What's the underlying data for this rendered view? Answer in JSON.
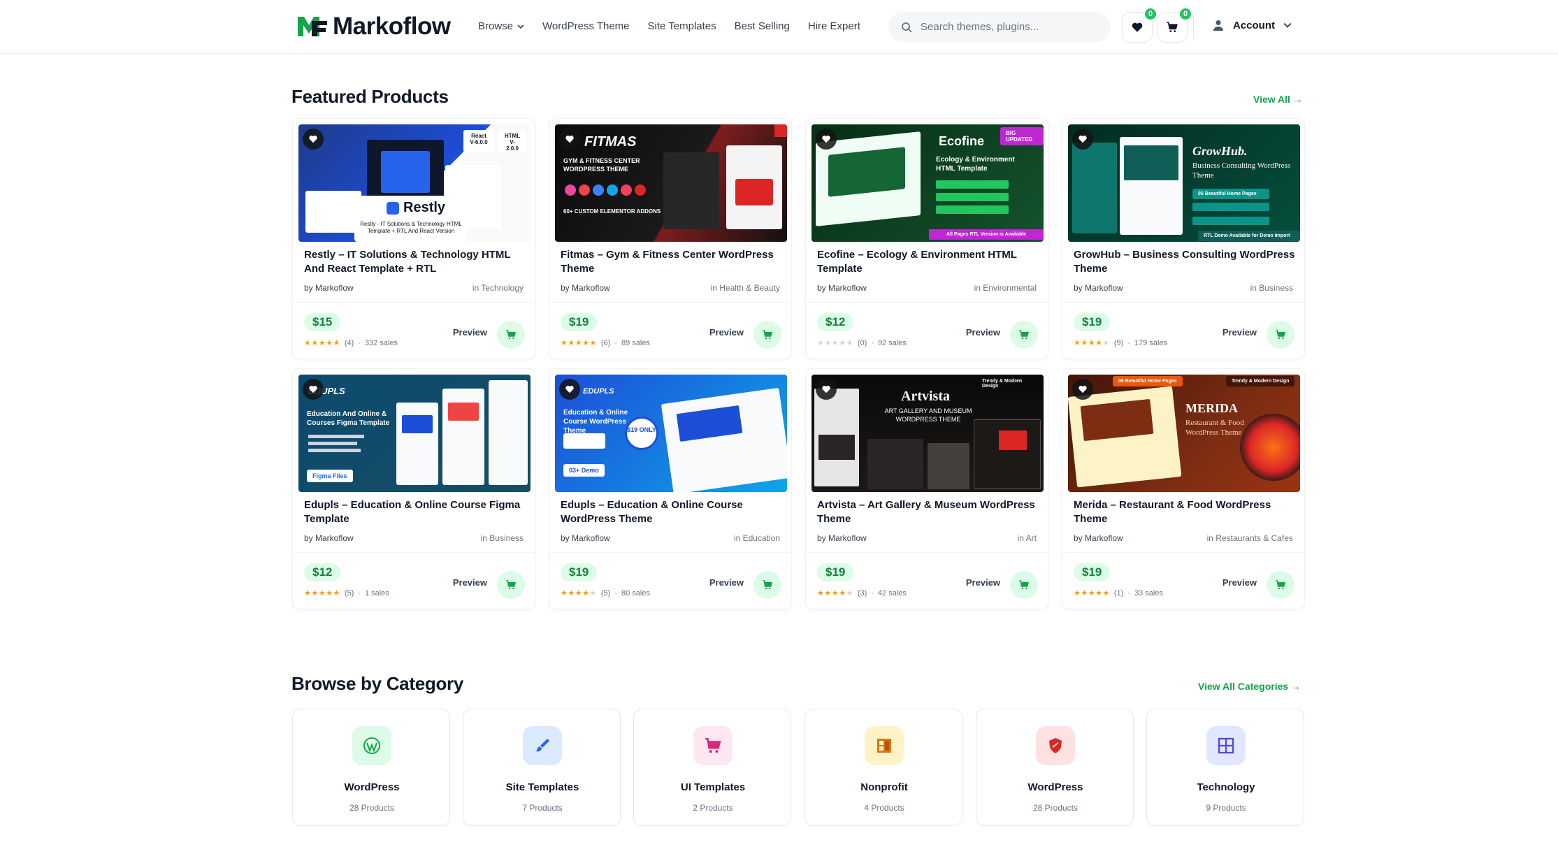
{
  "brand": {
    "name": "Markoflow",
    "accent": "#16a34a"
  },
  "nav": {
    "items": [
      {
        "label": "Browse",
        "has_dropdown": true
      },
      {
        "label": "WordPress Theme"
      },
      {
        "label": "Site Templates"
      },
      {
        "label": "Best Selling"
      },
      {
        "label": "Hire Expert"
      }
    ]
  },
  "search": {
    "placeholder": "Search themes, plugins...",
    "value": ""
  },
  "header_actions": {
    "wishlist_count": "0",
    "cart_count": "0",
    "account_label": "Account"
  },
  "featured": {
    "title": "Featured Products",
    "view_all": "View All →",
    "products": [
      {
        "thumb": {
          "headline": "Restly",
          "tagline": "Restly - IT Solutions & Technology HTML Template + RTL And React Version",
          "pills": [
            "React V-6.0.0",
            "HTML V-2.0.0"
          ]
        },
        "title": "Restly – IT Solutions & Technology HTML And React Template + RTL",
        "author": "by Markoflow",
        "category": "in Technology",
        "price": "$15",
        "rating": 5,
        "reviews": "(4)",
        "sales": "332 sales"
      },
      {
        "thumb": {
          "headline": "FITMAS",
          "tagline": "GYM & FITNESS CENTER WORDPRESS THEME",
          "pills": [
            "60+ CUSTOM ELEMENTOR ADDONS"
          ]
        },
        "title": "Fitmas – Gym & Fitness Center WordPress Theme",
        "author": "by Markoflow",
        "category": "in Health & Beauty",
        "price": "$19",
        "rating": 5,
        "reviews": "(6)",
        "sales": "89 sales"
      },
      {
        "thumb": {
          "headline": "Ecofine",
          "tagline": "Ecology & Environment HTML Template",
          "pills": [
            "BIG UPDATED",
            "All Pages RTL Version is Available"
          ]
        },
        "title": "Ecofine – Ecology & Environment HTML Template",
        "author": "by Markoflow",
        "category": "in Environmental",
        "price": "$12",
        "rating": 0,
        "reviews": "(0)",
        "sales": "92 sales"
      },
      {
        "thumb": {
          "headline": "GrowHub.",
          "tagline": "Business Consulting WordPress Theme",
          "pills": [
            "05 Beautiful Home Pages",
            "RTL Demo Available for Demo Import"
          ]
        },
        "title": "GrowHub – Business Consulting WordPress Theme",
        "author": "by Markoflow",
        "category": "in Business",
        "price": "$19",
        "rating": 4,
        "reviews": "(9)",
        "sales": "179 sales"
      },
      {
        "thumb": {
          "headline": "EDUPLS",
          "tagline": "Education And Online & Courses Figma Template",
          "pills": [
            "Figma Files"
          ]
        },
        "title": "Edupls – Education & Online Course Figma Template",
        "author": "by Markoflow",
        "category": "in Business",
        "price": "$12",
        "rating": 5,
        "reviews": "(5)",
        "sales": "1 sales"
      },
      {
        "thumb": {
          "headline": "EDUPLS",
          "tagline": "Education & Online Course WordPress Theme",
          "pills": [
            "$19 ONLY",
            "03+ Demo"
          ]
        },
        "title": "Edupls – Education & Online Course WordPress Theme",
        "author": "by Markoflow",
        "category": "in Education",
        "price": "$19",
        "rating": 4,
        "reviews": "(5)",
        "sales": "80 sales"
      },
      {
        "thumb": {
          "headline": "Artvista",
          "tagline": "ART GALLERY AND MUSEUM WORDPRESS THEME",
          "pills": [
            "Trendy & Modren Design"
          ]
        },
        "title": "Artvista – Art Gallery & Museum WordPress Theme",
        "author": "by Markoflow",
        "category": "in Art",
        "price": "$19",
        "rating": 4,
        "reviews": "(3)",
        "sales": "42 sales"
      },
      {
        "thumb": {
          "headline": "MERIDA",
          "tagline": "Restaurant & Food WordPress Theme",
          "pills": [
            "06 Beautiful Home Pages",
            "Trendy & Modern Design"
          ]
        },
        "title": "Merida – Restaurant & Food WordPress Theme",
        "author": "by Markoflow",
        "category": "in Restaurants & Cafes",
        "price": "$19",
        "rating": 5,
        "reviews": "(1)",
        "sales": "33 sales"
      }
    ],
    "preview_label": "Preview"
  },
  "categories": {
    "title": "Browse by Category",
    "view_all": "View All Categories →",
    "items": [
      {
        "name": "WordPress",
        "count": "28 Products",
        "icon": "wordpress-icon",
        "bg": "#dcfce7",
        "fg": "#16a34a"
      },
      {
        "name": "Site Templates",
        "count": "7 Products",
        "icon": "brush-icon",
        "bg": "#dbeafe",
        "fg": "#2563eb"
      },
      {
        "name": "UI Templates",
        "count": "2 Products",
        "icon": "cart-icon",
        "bg": "#fce7f3",
        "fg": "#db2777"
      },
      {
        "name": "Nonprofit",
        "count": "4 Products",
        "icon": "grid-icon",
        "bg": "#fef3c7",
        "fg": "#d97706"
      },
      {
        "name": "WordPress",
        "count": "28 Products",
        "icon": "shield-icon",
        "bg": "#fee2e2",
        "fg": "#dc2626"
      },
      {
        "name": "Technology",
        "count": "9 Products",
        "icon": "layout-icon",
        "bg": "#e0e7ff",
        "fg": "#4f46e5"
      }
    ]
  }
}
